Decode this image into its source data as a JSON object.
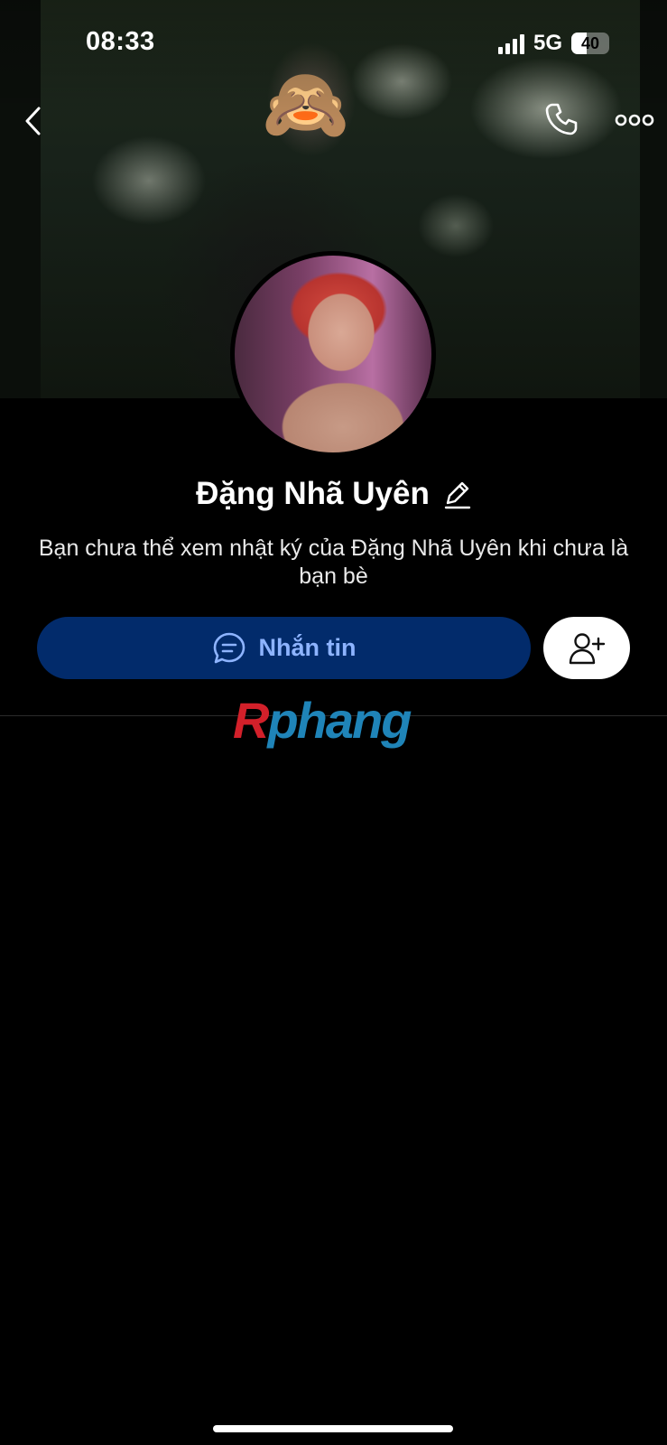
{
  "status_bar": {
    "time": "08:33",
    "network": "5G",
    "battery": "40",
    "battery_level": 0.4
  },
  "nav": {
    "back_icon": "chevron-left-icon",
    "call_icon": "phone-icon",
    "more_icon": "more-dots-icon"
  },
  "cover": {
    "face_sticker": "🙈"
  },
  "profile": {
    "name": "Đặng Nhã Uyên",
    "edit_icon": "pencil-icon",
    "notice": "Bạn chưa thể xem nhật ký của Đặng Nhã Uyên khi chưa là bạn bè"
  },
  "actions": {
    "message_label": "Nhắn tin",
    "message_icon": "chat-bubble-icon",
    "add_friend_icon": "add-friend-icon"
  },
  "watermark": {
    "first": "R",
    "rest": "phang"
  },
  "colors": {
    "message_button_bg": "#022b6b",
    "message_button_text": "#8eb4ff",
    "watermark_red": "#d3202a",
    "watermark_blue": "#1f84b8"
  }
}
